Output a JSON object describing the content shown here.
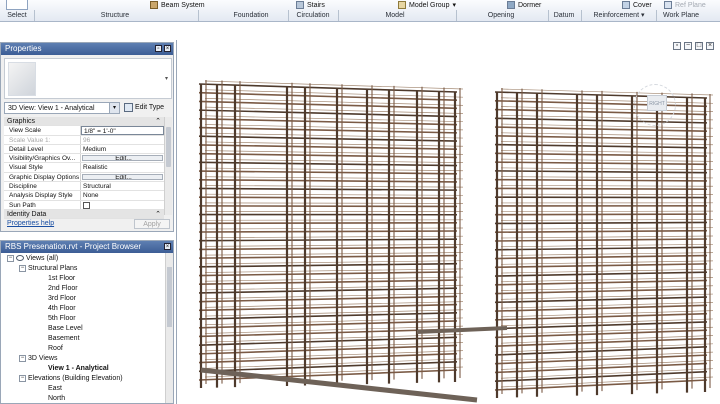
{
  "ribbon": {
    "top_items": {
      "beam_system": "Beam System",
      "stairs": "Stairs",
      "model_group": "Model Group",
      "dormer": "Dormer",
      "cover": "Cover",
      "ref_plane": "Ref Plane"
    },
    "panels": {
      "select": "Select",
      "structure": "Structure",
      "foundation": "Foundation",
      "circulation": "Circulation",
      "model": "Model",
      "opening": "Opening",
      "datum": "Datum",
      "reinforcement": "Reinforcement",
      "work_plane": "Work Plane"
    }
  },
  "properties": {
    "title": "Properties",
    "view_type": "3D View: View 1 - Analytical",
    "edit_type": "Edit Type",
    "groups": {
      "graphics": "Graphics",
      "identity": "Identity Data"
    },
    "rows": [
      {
        "key": "View Scale",
        "value": "1/8\" = 1'-0\""
      },
      {
        "key": "Scale Value  1:",
        "value": "96"
      },
      {
        "key": "Detail Level",
        "value": "Medium"
      },
      {
        "key": "Visibility/Graphics Ov...",
        "value": "Edit..."
      },
      {
        "key": "Visual Style",
        "value": "Realistic"
      },
      {
        "key": "Graphic Display Options",
        "value": "Edit..."
      },
      {
        "key": "Discipline",
        "value": "Structural"
      },
      {
        "key": "Analysis Display Style",
        "value": "None"
      },
      {
        "key": "Sun Path",
        "value": ""
      }
    ],
    "help": "Properties help",
    "apply": "Apply"
  },
  "browser": {
    "title": "RBS Presenation.rvt - Project Browser",
    "nodes": {
      "views_all": "Views (all)",
      "structural_plans": "Structural Plans",
      "floor1": "1st Floor",
      "floor2": "2nd Floor",
      "floor3": "3rd Floor",
      "floor4": "4th Floor",
      "floor5": "5th Floor",
      "base_level": "Base Level",
      "basement": "Basement",
      "roof": "Roof",
      "views_3d": "3D Views",
      "view1": "View 1 - Analytical",
      "elevations": "Elevations (Building Elevation)",
      "east": "East",
      "north": "North"
    }
  },
  "viewport": {
    "viewcube_label": "RIGHT"
  },
  "colors": {
    "steel": "#7a5a45",
    "steel_dark": "#4e3a2c",
    "panel_header": "#4a6ba3"
  }
}
